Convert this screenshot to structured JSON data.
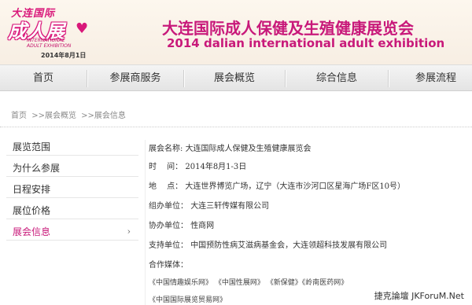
{
  "header": {
    "logo_top": "大连国际",
    "logo_main": "成人展",
    "logo_en_line1": "INTERNATIONAL",
    "logo_en_line2": "ADULT EXHIBITION",
    "logo_date": "2014年8月1日",
    "title_cn": "大连国际成人保健及生殖健康展览会",
    "title_en": "2014 dalian international adult exhibition",
    "accent_color": "#c8197a"
  },
  "nav": {
    "items": [
      "首页",
      "参展商服务",
      "展会概览",
      "综合信息",
      "参展流程"
    ]
  },
  "breadcrumb": {
    "home": "首页",
    "sep1": ">>",
    "level1": "展会概览",
    "sep2": ">>",
    "level2": "展会信息"
  },
  "sidebar": {
    "items": [
      "展览范围",
      "为什么参展",
      "日程安排",
      "展位价格",
      "展会信息"
    ],
    "active_index": 4,
    "arrow": "›"
  },
  "content": {
    "rows": [
      {
        "label": "展会名称:",
        "value": "大连国际成人保健及生殖健康展览会"
      },
      {
        "label": "时　 间：",
        "value": "2014年8月1-3日"
      },
      {
        "label": "地　 点：",
        "value": "大连世界博览广场，辽宁（大连市沙河口区星海广场F区10号）"
      },
      {
        "label": "组办单位：",
        "value": "大连三轩传媒有限公司"
      },
      {
        "label": "协办单位：",
        "value": "性商网"
      },
      {
        "label": "支持单位：",
        "value": "中国预防性病艾滋病基金会，大连领超科技发展有限公司"
      },
      {
        "label": "合作媒体：",
        "value": ""
      }
    ],
    "media_line1": "《中国情趣娱乐网》 《中国性展网》 《新保健》《岭南医药网》",
    "media_line2": "《中国国际展览贸易网》"
  },
  "watermark": "捷克論壇 JKForuM.Net"
}
